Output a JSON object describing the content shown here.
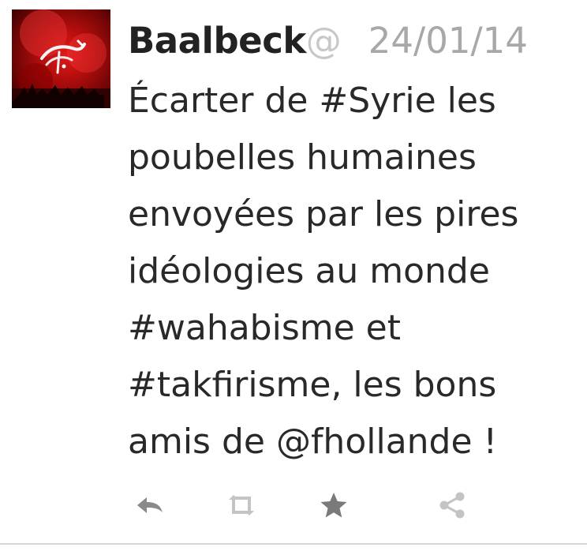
{
  "tweet": {
    "author_name": "Baalbeck",
    "handle": "@",
    "date": "24/01/14",
    "text": "Écarter de #Syrie les\npoubelles humaines\nenvoyées par les pires\nidéologies au monde\n#wahabisme et\n#takfirisme, les bons\namis de @fhollande !"
  },
  "actions": [
    {
      "name": "reply",
      "icon": "reply-icon"
    },
    {
      "name": "retweet",
      "icon": "retweet-icon"
    },
    {
      "name": "favorite",
      "icon": "star-icon"
    },
    {
      "name": "share",
      "icon": "share-icon"
    }
  ],
  "colors": {
    "name": "#222222",
    "handle": "#c8c8c8",
    "date": "#a8a8a8",
    "text": "#292929",
    "icon": "#8a8a8a",
    "icon_light": "#c4c4c4",
    "avatar_red": "#c41212"
  }
}
